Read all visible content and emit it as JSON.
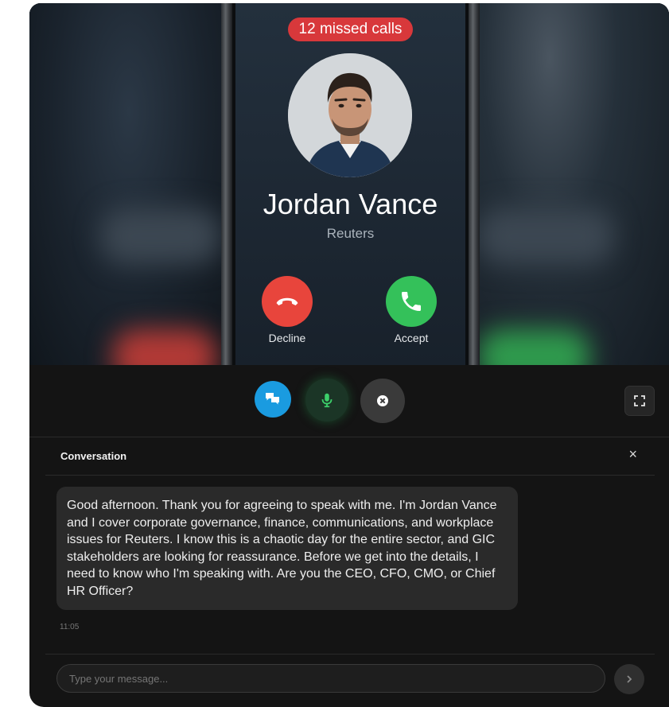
{
  "call": {
    "missed_badge": "12 missed calls",
    "caller_name": "Jordan Vance",
    "caller_org": "Reuters",
    "decline_label": "Decline",
    "accept_label": "Accept"
  },
  "controls": {
    "chat_icon": "chat-bubbles-icon",
    "mic_icon": "microphone-icon",
    "end_icon": "close-circle-icon",
    "fullscreen_icon": "fullscreen-icon"
  },
  "conversation": {
    "title": "Conversation",
    "close_glyph": "×",
    "messages": [
      {
        "text": "Good afternoon. Thank you for agreeing to speak with me. I'm Jordan Vance and I cover corporate governance, finance, communications, and workplace issues for Reuters. I know this is a chaotic day for the entire sector, and GIC stakeholders are looking for reassurance. Before we get into the details, I need to know who I'm speaking with. Are you the CEO, CFO, CMO, or Chief HR Officer?",
        "time": "11:05"
      }
    ]
  },
  "composer": {
    "placeholder": "Type your message...",
    "send_icon": "chevron-right-icon"
  },
  "colors": {
    "missed_badge": "#d8383b",
    "decline": "#e8453c",
    "accept": "#34c15a",
    "chat_button": "#1a9be0",
    "mic_icon": "#3ccf6a"
  }
}
